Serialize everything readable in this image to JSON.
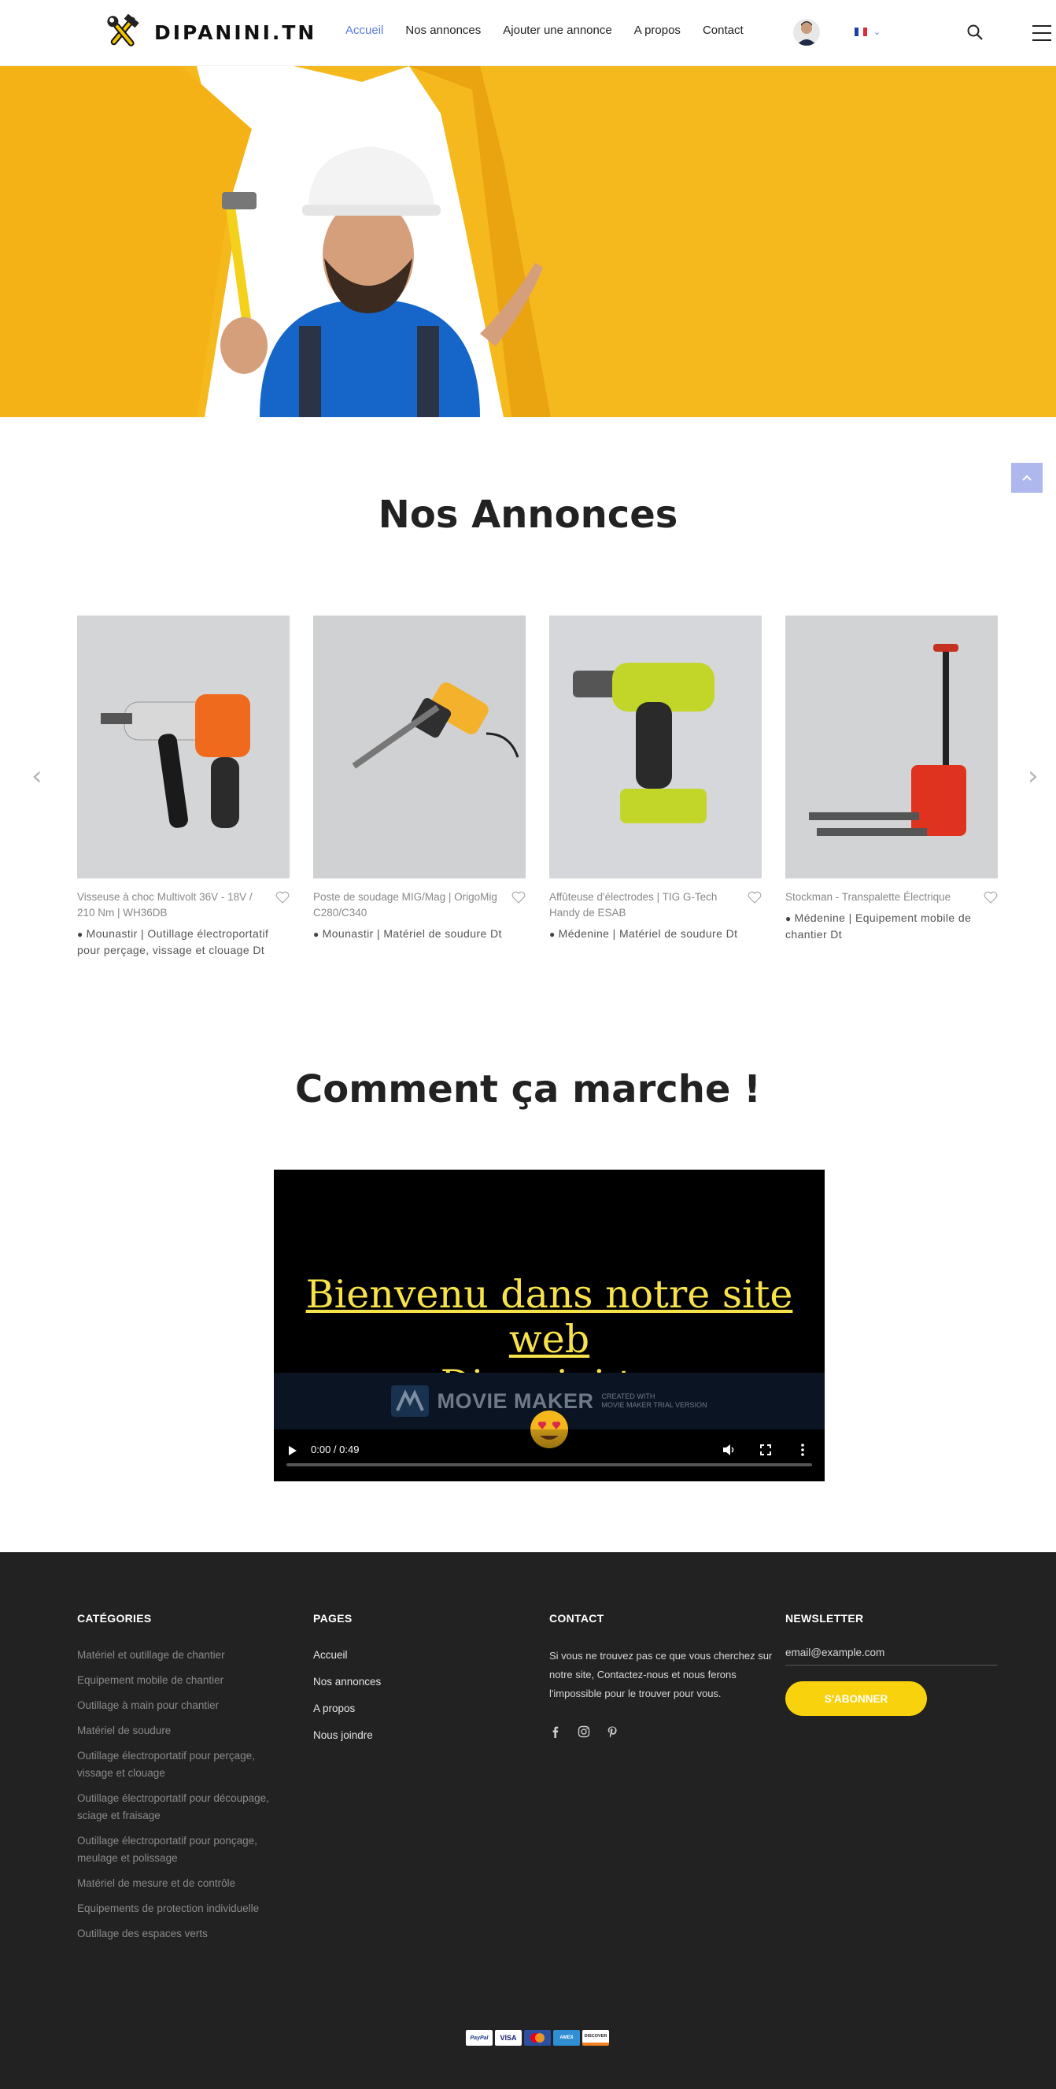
{
  "header": {
    "logo_text": "DIPANINI.TN",
    "nav": [
      "Accueil",
      "Nos annonces",
      "Ajouter une annonce",
      "A propos",
      "Contact"
    ],
    "active_nav": "Accueil",
    "language_flag": "flag-fr-icon",
    "accent_color": "#5b7be0"
  },
  "hero": {
    "background_color": "#f7c226"
  },
  "annonces": {
    "title": "Nos Annonces",
    "cards": [
      {
        "title": "Visseuse à choc Multivolt 36V - 18V / 210 Nm | WH36DB",
        "location": "Mounastir | Outillage électroportatif pour perçage, vissage et clouage Dt"
      },
      {
        "title": "Poste de soudage MIG/Mag | OrigoMig C280/C340",
        "location": "Mounastir | Matériel de soudure Dt"
      },
      {
        "title": "Affûteuse d'électrodes | TIG G-Tech Handy de ESAB",
        "location": "Médenine | Matériel de soudure Dt"
      },
      {
        "title": "Stockman - Transpalette Électrique",
        "location": "Médenine | Equipement mobile de chantier Dt"
      }
    ]
  },
  "how_it_works": {
    "title": "Comment ça marche !",
    "video": {
      "line1": "Bienvenu  dans notre site web",
      "line2": "Dipanini.tn",
      "brand": "MOVIE MAKER",
      "brand_sub1": "CREATED WITH",
      "brand_sub2": "MOVIE MAKER TRIAL VERSION",
      "time": "0:00 / 0:49",
      "progress": 0
    }
  },
  "footer": {
    "categories": {
      "heading": "CATÉGORIES",
      "items": [
        "Matériel et outillage de chantier",
        "Equipement mobile de chantier",
        "Outillage à main pour chantier",
        "Matériel de soudure",
        "Outillage électroportatif pour perçage, vissage et clouage",
        "Outillage électroportatif pour découpage, sciage et fraisage",
        "Outillage électroportatif pour ponçage, meulage et polissage",
        "Matériel de mesure et de contrôle",
        "Equipements de protection individuelle",
        "Outillage des espaces verts"
      ]
    },
    "pages": {
      "heading": "PAGES",
      "items": [
        "Accueil",
        "Nos annonces",
        "A propos",
        "Nous joindre"
      ]
    },
    "contact": {
      "heading": "CONTACT",
      "text": "Si vous ne trouvez pas ce que vous cherchez sur notre site, Contactez-nous et nous ferons l'impossible pour le trouver pour vous.",
      "socials": [
        "facebook-icon",
        "instagram-icon",
        "pinterest-icon"
      ]
    },
    "newsletter": {
      "heading": "NEWSLETTER",
      "placeholder": "email@example.com",
      "button": "S'ABONNER",
      "button_color": "#f9d20e"
    },
    "payments": [
      "PayPal",
      "VISA",
      "MC",
      "AMEX",
      "DISCOVER"
    ]
  }
}
